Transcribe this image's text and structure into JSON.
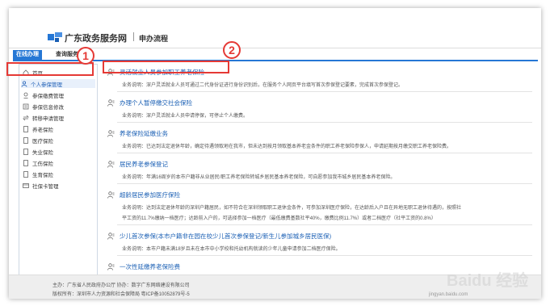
{
  "header": {
    "brand": "广东政务服务网",
    "subtitle": "申办流程"
  },
  "tabs": [
    {
      "label": "在线办理",
      "active": true
    },
    {
      "label": "查询服务",
      "active": false
    }
  ],
  "sidebar": {
    "items": [
      {
        "label": "首页",
        "icon": "home-icon"
      },
      {
        "label": "个人参保管理",
        "icon": "user-icon",
        "active": true
      },
      {
        "label": "参保缴费管理",
        "icon": "payment-icon"
      },
      {
        "label": "参保信息修改",
        "icon": "edit-icon"
      },
      {
        "label": "转移申请管理",
        "icon": "transfer-icon"
      },
      {
        "label": "养老保险",
        "icon": "document-icon"
      },
      {
        "label": "医疗保险",
        "icon": "document-icon"
      },
      {
        "label": "失业保险",
        "icon": "document-icon"
      },
      {
        "label": "工伤保险",
        "icon": "document-icon"
      },
      {
        "label": "生育保险",
        "icon": "document-icon"
      },
      {
        "label": "社保卡管理",
        "icon": "card-icon"
      }
    ]
  },
  "annotations": {
    "marker1": "1",
    "marker2": "2"
  },
  "services": [
    {
      "title": "灵活就业人员参加职工养老保险",
      "desc": "业务说明：深户灵活就业人员可通过二代身份证进行身份识别后，在服务个人网页平台填写首次参保登记要素，完成首次参保登记。",
      "desc2": ""
    },
    {
      "title": "办理个人暂停缴交社会保险",
      "desc": "业务说明：深户灵活就业人员申请停保，可停止个人缴费。",
      "desc2": ""
    },
    {
      "title": "养老保险延缴业务",
      "desc": "业务说明：已达到法定退休年龄，确定待遇领取地在我市，但未达到按月领取基本养老金条件的职工养老保险参保人，申请延期按月缴交职工养老保险费。",
      "desc2": ""
    },
    {
      "title": "居民养老参保登记",
      "desc": "业务说明：年满16周岁的本市户籍非从业居民/职工养老保险转城乡居民基本养老保险，可自愿参加我市城乡居民基本养老保险。",
      "desc2": ""
    },
    {
      "title": "超龄居民参加医疗保险",
      "desc": "业务说明：达到法定退休年龄的深圳户籍居民，如不符合在深圳领取职工退休金条件，可参加深圳医疗保险，在达龄后入户且在异地无职工退休待遇的，按照社",
      "desc2": "平工资的11.7%缴纳一档医疗；达龄前入户的，可选择参加一档医疗（最低缴费基数社平40%，缴费比例11.7%）或者二档医疗（社平工资的0.8%）"
    },
    {
      "title": "少儿首次参保(本市户籍非在园在校少儿首次参保登记/新生儿参加城乡居民医保)",
      "desc": "业务说明：本市户籍未满18岁且未在本市中小学校和托幼机构就读的少年儿童申请参加二档医疗保险。",
      "desc2": ""
    },
    {
      "title": "一次性延缴养老保险费",
      "desc": "",
      "desc2": ""
    }
  ],
  "footer": {
    "line1": "主办：广东省人民政府办公厅    协办：数字广东网络建设有限公司",
    "line2": "版权所有：深圳市人力资源和社会保障局  粤ICP备10052879号-5"
  },
  "watermark": {
    "brand": "Baidu 经验",
    "url": "jingyan.baidu.com"
  },
  "colors": {
    "accent": "#2577d5",
    "link": "#1a5fb4",
    "annotation": "#e53935"
  }
}
